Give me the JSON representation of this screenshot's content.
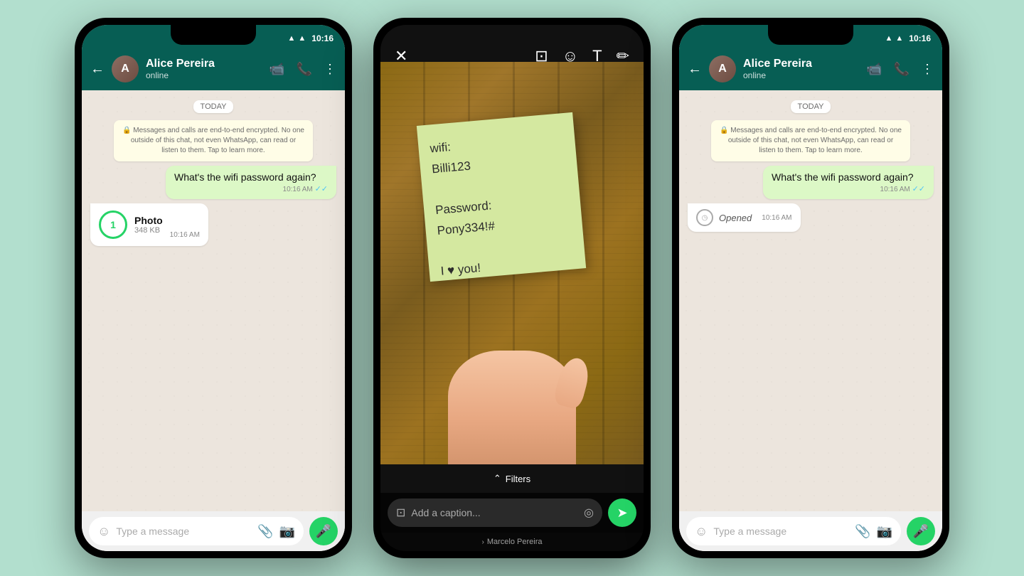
{
  "background_color": "#b2dfce",
  "phone1": {
    "status_bar": {
      "time": "10:16",
      "wifi": "▲",
      "signal": "▲",
      "battery": "▮"
    },
    "header": {
      "contact_name": "Alice Pereira",
      "contact_status": "online",
      "back_label": "←",
      "video_icon": "📹",
      "call_icon": "📞",
      "more_icon": "⋮"
    },
    "messages": {
      "date_badge": "TODAY",
      "encryption_notice": "🔒 Messages and calls are end-to-end encrypted. No one outside of this chat, not even WhatsApp, can read or listen to them. Tap to learn more.",
      "sent_message": "What's the wifi password again?",
      "sent_time": "10:16 AM",
      "sent_ticks": "✓✓",
      "photo_label": "Photo",
      "photo_size": "348 KB",
      "photo_time": "10:16 AM"
    },
    "input": {
      "placeholder": "Type a message",
      "emoji_icon": "☺",
      "attach_icon": "📎",
      "camera_icon": "📷",
      "mic_icon": "🎤"
    }
  },
  "phone2": {
    "toolbar": {
      "close_icon": "✕",
      "crop_icon": "⊡",
      "emoji_icon": "☺",
      "text_icon": "T",
      "draw_icon": "✏"
    },
    "sticky_note": {
      "text": "wifi:\nBilli123\n\nPassword:\nPony334!#\n\nI ♥ you!"
    },
    "filters": {
      "label": "Filters",
      "chevron": "⌃"
    },
    "caption": {
      "icon": "⊡",
      "placeholder": "Add a caption...",
      "one_time_icon": "◎",
      "send_icon": "➤"
    },
    "credit": {
      "chevron": "›",
      "text": "Marcelo Pereira"
    }
  },
  "phone3": {
    "status_bar": {
      "time": "10:16"
    },
    "header": {
      "contact_name": "Alice Pereira",
      "contact_status": "online",
      "back_label": "←"
    },
    "messages": {
      "date_badge": "TODAY",
      "encryption_notice": "🔒 Messages and calls are end-to-end encrypted. No one outside of this chat, not even WhatsApp, can read or listen to them. Tap to learn more.",
      "sent_message": "What's the wifi password again?",
      "sent_time": "10:16 AM",
      "sent_ticks": "✓✓",
      "opened_text": "Opened",
      "opened_time": "10:16 AM"
    },
    "input": {
      "placeholder": "Type a message",
      "emoji_icon": "☺",
      "attach_icon": "📎",
      "camera_icon": "📷",
      "mic_icon": "🎤"
    }
  }
}
